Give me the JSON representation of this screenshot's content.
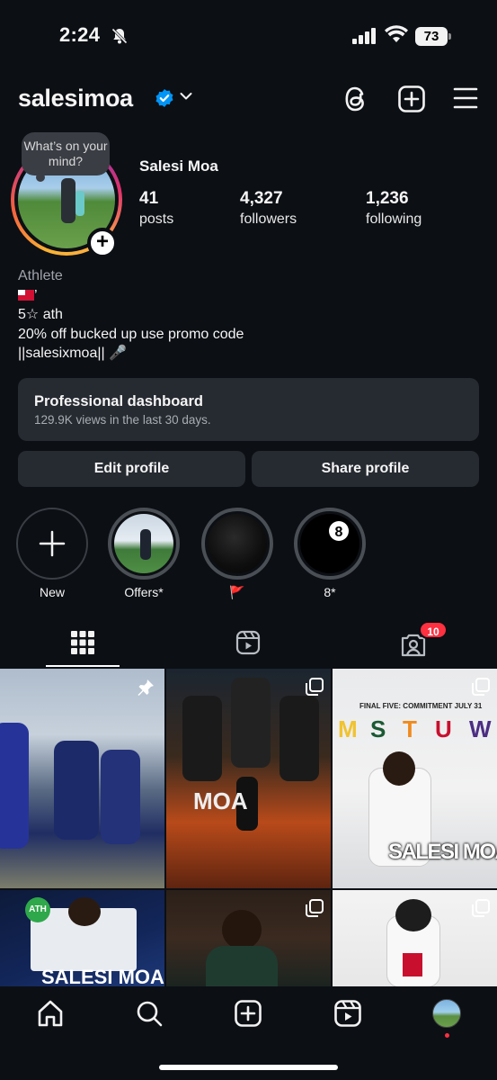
{
  "status_bar": {
    "time": "2:24",
    "battery": "73"
  },
  "header": {
    "username": "salesimoa"
  },
  "profile": {
    "note": "What’s on your mind?",
    "display_name": "Salesi Moa",
    "stats": [
      {
        "value": "41",
        "label": "posts"
      },
      {
        "value": "4,327",
        "label": "followers"
      },
      {
        "value": "1,236",
        "label": "following"
      }
    ],
    "category": "Athlete",
    "bio_line1_suffix": "’",
    "bio_line2": "5☆ ath",
    "bio_line3": "20% off bucked up use promo code",
    "bio_line4": "||salesixmoa||  🎤"
  },
  "dashboard": {
    "title": "Professional dashboard",
    "subtitle": "129.9K views in the last 30 days."
  },
  "buttons": {
    "edit": "Edit profile",
    "share": "Share profile"
  },
  "highlights": [
    {
      "label": "New"
    },
    {
      "label": "Offers*"
    },
    {
      "label": "🚩"
    },
    {
      "label": "8*"
    }
  ],
  "tabs": {
    "tagged_badge": "10"
  },
  "posts": [
    {
      "caption": ""
    },
    {
      "caption": "MOA"
    },
    {
      "headline": "FINAL FIVE: COMMITMENT JULY 31",
      "name": "SALESI MOA"
    },
    {
      "badge": "ATH",
      "name": "SALESI MOA"
    },
    {
      "caption": ""
    },
    {
      "caption": ""
    }
  ],
  "colors": {
    "background": "#0c0f14",
    "card": "#262a31",
    "verified": "#0095f6",
    "notification": "#ff3040"
  }
}
